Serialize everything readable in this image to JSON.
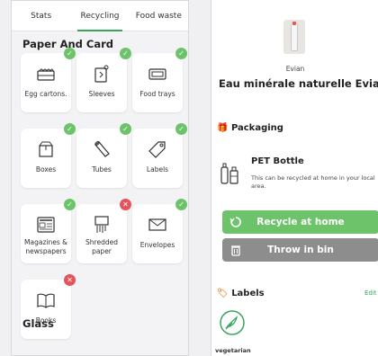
{
  "left": {
    "tabs": [
      "Stats",
      "Recycling",
      "Food waste"
    ],
    "active_tab": "Recycling",
    "section_title": "Paper And Card",
    "items": [
      {
        "label": "Egg cartons.",
        "icon": "egg-carton-icon",
        "status": "check"
      },
      {
        "label": "Sleeves",
        "icon": "sleeve-icon",
        "status": "check"
      },
      {
        "label": "Food trays",
        "icon": "food-tray-icon",
        "status": "check"
      },
      {
        "label": "Boxes",
        "icon": "box-icon",
        "status": "check"
      },
      {
        "label": "Tubes",
        "icon": "tube-icon",
        "status": "check"
      },
      {
        "label": "Labels",
        "icon": "tag-icon",
        "status": "check"
      },
      {
        "label": "Magazines & newspapers",
        "icon": "newspaper-icon",
        "status": "check"
      },
      {
        "label": "Shredded paper",
        "icon": "shredded-paper-icon",
        "status": "cross"
      },
      {
        "label": "Envelopes",
        "icon": "envelope-icon",
        "status": "check"
      },
      {
        "label": "Books",
        "icon": "book-icon",
        "status": "cross"
      }
    ],
    "next_section": "Glass",
    "colors": {
      "accent": "#3aa45f",
      "check": "#6cc36a",
      "cross": "#e4545c"
    }
  },
  "right": {
    "brand": "Evian",
    "product_name": "Eau minérale naturelle Evian",
    "packaging_heading": "Packaging",
    "packaging_item": "PET Bottle",
    "packaging_desc": "This can be recycled at home in your local area.",
    "recycle_button": "Recycle at home",
    "bin_button": "Throw in bin",
    "labels_heading": "Labels",
    "edit_link": "Edit",
    "label_name": "vegetarian",
    "colors": {
      "green_button": "#6cc36a",
      "grey_button": "#8d8d8d"
    }
  }
}
